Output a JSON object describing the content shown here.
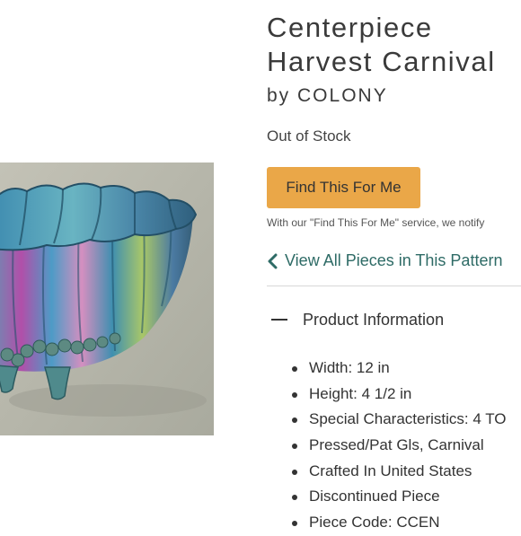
{
  "product": {
    "title_line1": "Centerpiece",
    "title_line2": "Harvest Carnival",
    "maker": "by COLONY",
    "stock_status": "Out of Stock",
    "find_button_label": "Find This For Me",
    "notify_text": "With our \"Find This For Me\" service, we notify",
    "pattern_link_label": "View All Pieces in This Pattern",
    "image_alt": "Centerpiece Harvest Carnival"
  },
  "product_info": {
    "header": "Product Information",
    "items": [
      "Width: 12 in",
      "Height: 4 1/2 in",
      "Special Characteristics: 4 TO",
      "Pressed/Pat Gls, Carnival",
      "Crafted In United States",
      "Discontinued Piece",
      "Piece Code: CCEN"
    ]
  },
  "colors": {
    "accent_button": "#eaa748",
    "link_teal": "#2e6b66",
    "photo_background": "#b8b8ad"
  },
  "icons": {
    "back": "chevron-left-icon",
    "collapse": "minus-icon",
    "bullet": "bullet-icon"
  }
}
